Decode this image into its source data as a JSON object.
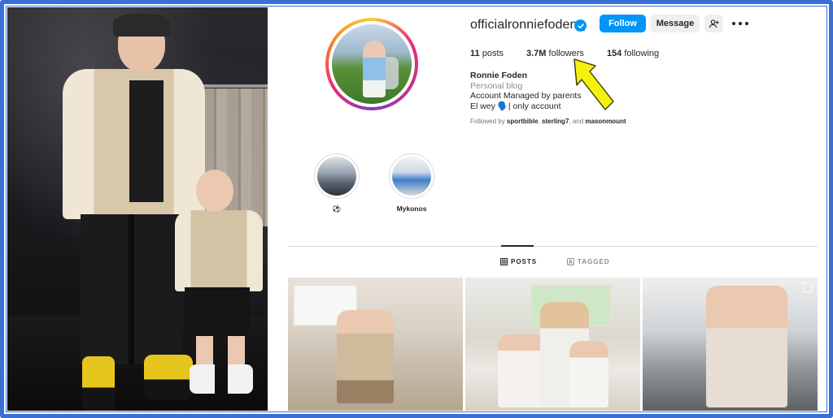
{
  "profile": {
    "username": "officialronniefoden_",
    "follow_label": "Follow",
    "message_label": "Message",
    "stats": {
      "posts_count": "11",
      "posts_label": "posts",
      "followers_count": "3.7M",
      "followers_label": "followers",
      "following_count": "154",
      "following_label": "following"
    },
    "bio": {
      "name": "Ronnie Foden",
      "category": "Personal blog",
      "line1": "Account Managed by parents",
      "line2": "El wey 🗣️| only account"
    },
    "followed_by": {
      "prefix": "Followed by",
      "user1": "sportbible",
      "user2": "sterling7",
      "user3": "masonmount",
      "sep1": ", ",
      "sep2": ", and "
    }
  },
  "highlights": [
    {
      "label": "⚽"
    },
    {
      "label": "Mykonos"
    }
  ],
  "tabs": {
    "posts": "POSTS",
    "tagged": "TAGGED"
  },
  "colors": {
    "accent": "#0095f6",
    "frame": "#3b6fd8",
    "arrow": "#f5f10f"
  },
  "icons": [
    "verified-badge-icon",
    "add-user-icon",
    "more-options-icon",
    "grid-icon",
    "tagged-icon",
    "multi-post-icon",
    "yellow-arrow-icon"
  ]
}
